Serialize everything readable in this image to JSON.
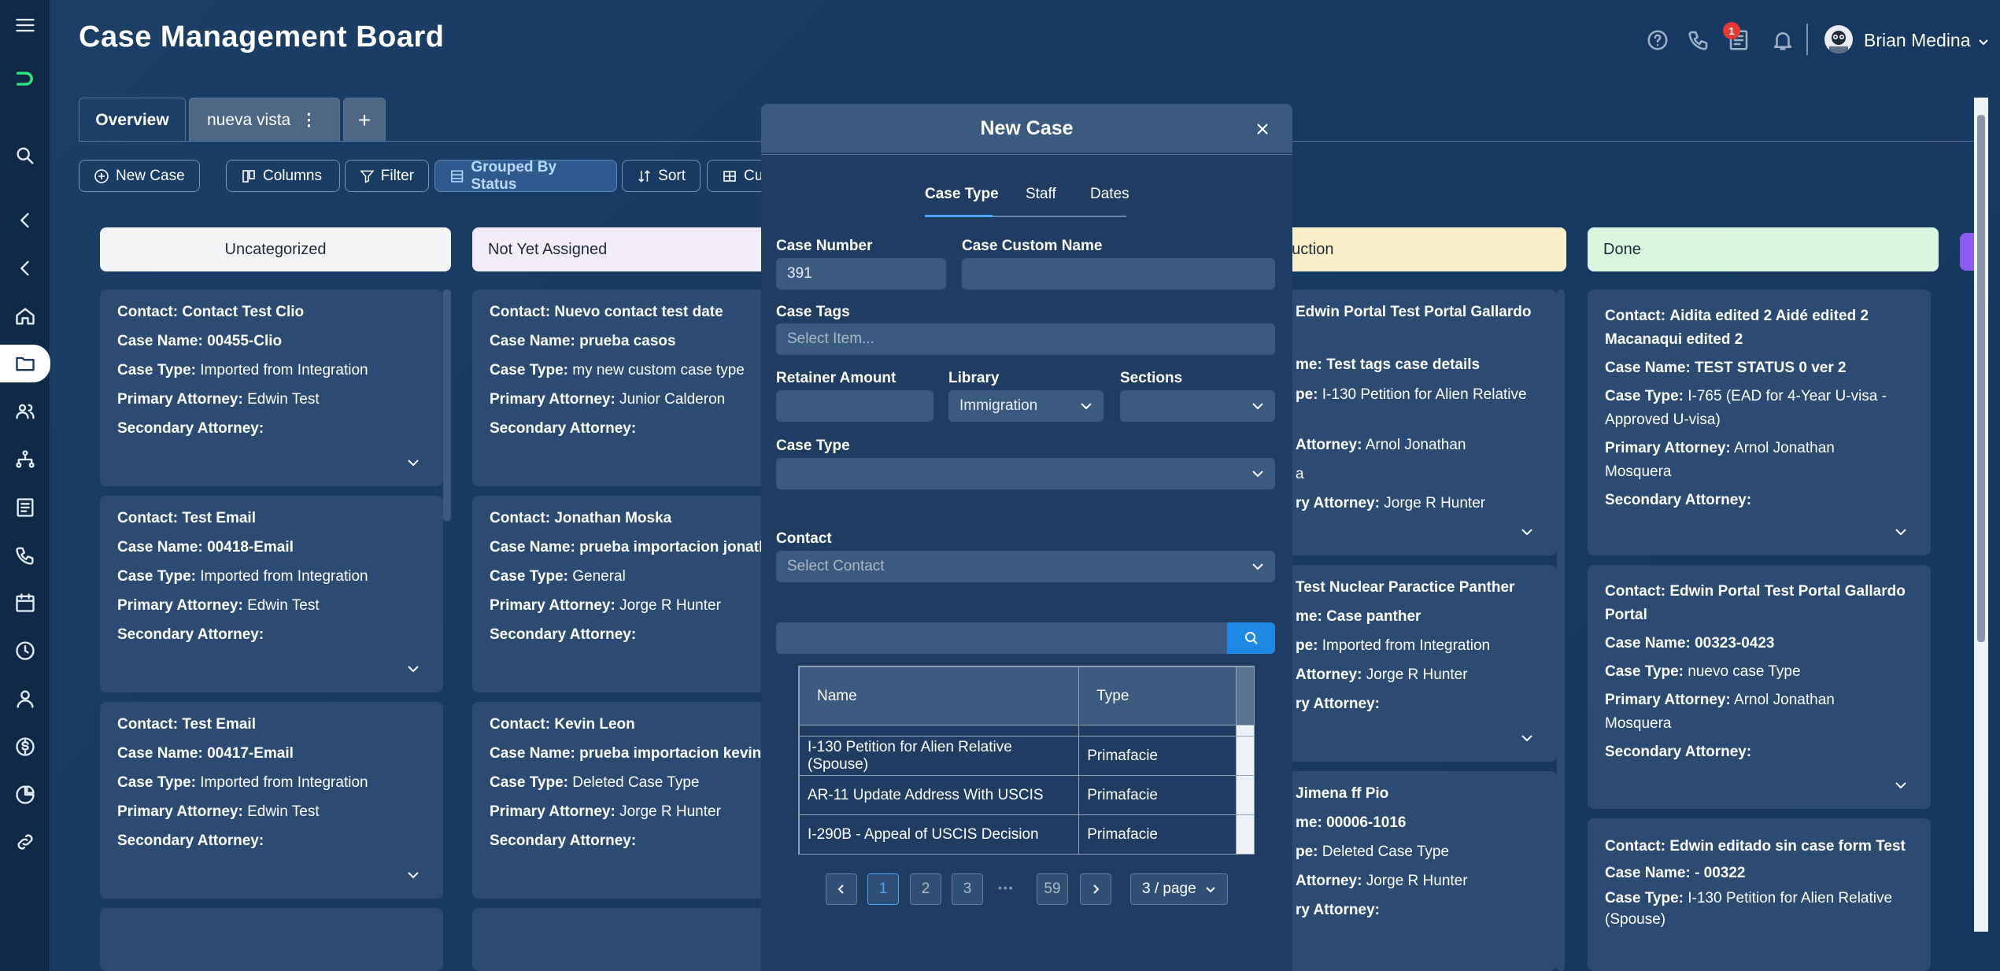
{
  "app": {
    "title": "Case Management Board",
    "user": "Brian Medina",
    "notifications_badge": "1"
  },
  "sidebar": {
    "icons": [
      "menu-icon",
      "logo-icon",
      "search-icon",
      "collapse-icon",
      "collapse-icon",
      "home-icon",
      "folder-icon",
      "people-icon",
      "sitemap-icon",
      "list-icon",
      "phone-icon",
      "calendar-icon",
      "clock-icon",
      "user-icon",
      "dollar-icon",
      "chart-icon",
      "link-icon"
    ]
  },
  "tabs": [
    {
      "label": "Overview"
    },
    {
      "label": "nueva vista"
    }
  ],
  "toolbar": {
    "new_case": "New Case",
    "columns": "Columns",
    "filter": "Filter",
    "grouped": "Grouped By Status",
    "sort": "Sort",
    "customize": "Cu"
  },
  "columns": [
    {
      "title": "Uncategorized",
      "color": "#f3f4f6",
      "cards": [
        {
          "contact": "Contact Test Clio",
          "case_name": "00455-Clio",
          "case_type": "Imported from Integration",
          "primary": "Edwin Test",
          "secondary": ""
        },
        {
          "contact": "Test Email",
          "case_name": "00418-Email",
          "case_type": "Imported from Integration",
          "primary": "Edwin Test",
          "secondary": ""
        },
        {
          "contact": "Test Email",
          "case_name": "00417-Email",
          "case_type": "Imported from Integration",
          "primary": "Edwin Test",
          "secondary": ""
        }
      ]
    },
    {
      "title": "Not Yet Assigned",
      "color": "#f3ecfb",
      "cards": [
        {
          "contact": "Nuevo contact test date",
          "case_name": "prueba casos",
          "case_type": "my new custom case type",
          "primary": "Junior Calderon",
          "secondary": ""
        },
        {
          "contact": "Jonathan Moska",
          "case_name": "prueba importacion jonath",
          "case_type": "General",
          "primary": "Jorge R Hunter",
          "secondary": ""
        },
        {
          "contact": "Kevin Leon",
          "case_name": "prueba importacion kevin",
          "case_type": "Deleted Case Type",
          "primary": "Jorge R Hunter",
          "secondary": ""
        }
      ]
    },
    {
      "title": "duction",
      "color": "#fbefc8",
      "cards": [
        {
          "contact": "Edwin Portal Test Portal Gallardo",
          "case_name": "me: Test tags case details",
          "case_type": "pe: I-130 Petition for Alien Relative",
          "primary": "Attorney: Arnol Jonathan",
          "primary2": "a",
          "secondary": "ry Attorney: Jorge R Hunter"
        },
        {
          "contact": "Test Nuclear Paractice Panther",
          "case_name": "me: Case panther",
          "case_type": "pe: Imported from Integration",
          "primary": "Attorney: Jorge R Hunter",
          "secondary": "ry Attorney:"
        },
        {
          "contact": "Jimena ff Pio",
          "case_name": "me: 00006-1016",
          "case_type": "pe: Deleted Case Type",
          "primary": "Attorney: Jorge R Hunter",
          "secondary": "ry Attorney:"
        }
      ]
    },
    {
      "title": "Done",
      "color": "#d9f7de",
      "cards": [
        {
          "contact": "Aidita edited 2 Aidé edited 2",
          "contact2": "Macanaqui edited 2",
          "case_name": "TEST STATUS 0 ver 2",
          "case_type": "I-765 (EAD for 4-Year U-visa -",
          "case_type2": "Approved U-visa)",
          "primary": "Arnol Jonathan",
          "primary2": "Mosquera",
          "secondary": ""
        },
        {
          "contact": "Edwin Portal Test Portal Gallardo",
          "contact2": "Portal",
          "case_name": "00323-0423",
          "case_type": "nuevo case Type",
          "primary": "Arnol Jonathan",
          "primary2": "Mosquera",
          "secondary": ""
        },
        {
          "contact": "Edwin editado sin case form Test",
          "case_name": "- 00322",
          "case_type": "I-130 Petition for Alien Relative",
          "case_type2": "(Spouse)"
        }
      ]
    }
  ],
  "labels": {
    "contact": "Contact:",
    "case_name": "Case Name:",
    "case_type": "Case Type:",
    "primary": "Primary Attorney:",
    "secondary": "Secondary Attorney:"
  },
  "modal": {
    "title": "New Case",
    "tabs": [
      "Case Type",
      "Staff",
      "Dates"
    ],
    "case_number_label": "Case Number",
    "case_number": "391",
    "custom_name_label": "Case Custom Name",
    "tags_label": "Case Tags",
    "tags_placeholder": "Select Item...",
    "retainer_label": "Retainer Amount",
    "library_label": "Library",
    "library_value": "Immigration",
    "sections_label": "Sections",
    "case_type_label": "Case Type",
    "contact_label": "Contact",
    "contact_placeholder": "Select Contact",
    "table": {
      "headers": [
        "Name",
        "Type"
      ],
      "rows": [
        [
          "I-130 Petition for Alien Relative (Spouse)",
          "Primafacie"
        ],
        [
          "AR-11 Update Address With USCIS",
          "Primafacie"
        ],
        [
          "I-290B - Appeal of USCIS Decision",
          "Primafacie"
        ]
      ]
    },
    "pagination": {
      "pages": [
        "1",
        "2",
        "3"
      ],
      "ellipsis": "•••",
      "last": "59",
      "page_size": "3 / page"
    }
  }
}
